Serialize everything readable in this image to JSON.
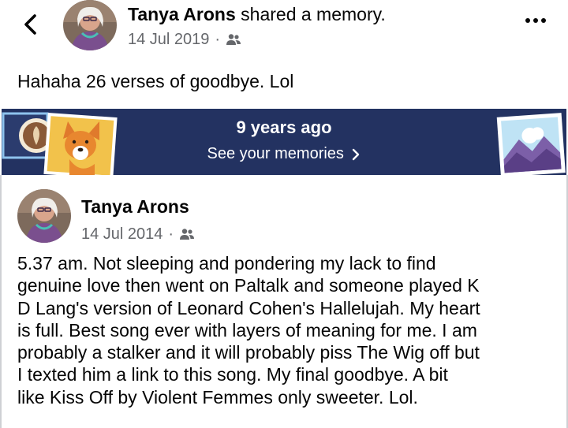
{
  "header": {
    "user_name": "Tanya Arons",
    "action": " shared a memory.",
    "date": "14 Jul 2019",
    "separator": "·",
    "audience_icon": "friends-icon",
    "back_icon": "chevron-left-icon",
    "more_icon": "more-options-icon"
  },
  "post": {
    "text": "Hahaha 26 verses of goodbye.  Lol"
  },
  "banner": {
    "title": "9 years ago",
    "link_label": "See your memories",
    "background_color": "#233261"
  },
  "shared_post": {
    "user_name": "Tanya Arons",
    "date": "14 Jul 2014",
    "separator": "·",
    "audience_icon": "friends-icon",
    "text": "5.37 am. Not sleeping and pondering my lack to find\ngenuine love then went on Paltalk and someone played K\nD Lang's version of Leonard Cohen's Hallelujah.  My heart\nis full. Best song ever with layers of meaning for me.  I am\nprobably a stalker and it will probably piss The Wig off but\nI texted him a link to this song.  My final goodbye.  A bit\nlike Kiss Off by Violent Femmes only sweeter. Lol."
  }
}
